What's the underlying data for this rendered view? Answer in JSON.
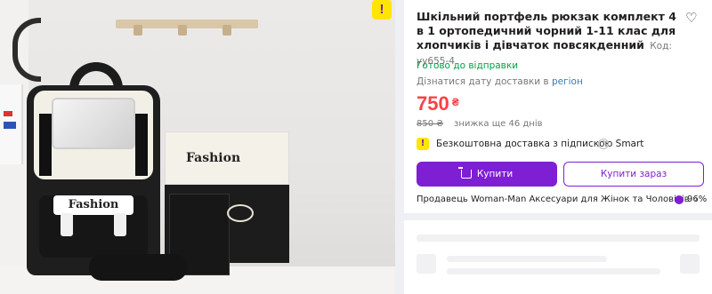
{
  "product": {
    "title": "Шкільний портфель рюкзак комплект 4 в 1 ор­топедичний чорний 1-11 клас для хлопчиків і дівчаток повсякденний",
    "code": "Код: уу655-4",
    "stock_status": "Готово до відправки",
    "delivery_prefix": "Дізнатися дату доставки в",
    "delivery_region": "регіон",
    "price": "750",
    "currency": "₴",
    "old_price": "850 ₴",
    "discount_note": "знижка ще 46 днів",
    "smart_text": "Безкоштовна доставка з підпискою Smart",
    "buy_label": "Купити",
    "buy_now_label": "Купити зараз",
    "seller_text": "Продавець Woman-Man Аксесуари для Жінок та Чоловіків",
    "seller_chevron": "›",
    "rating": "96%"
  },
  "image": {
    "bag_label_1": "Fashion",
    "bag_label_2": "Fashion"
  },
  "icons": {
    "brand": "!",
    "smart": "!",
    "heart": "♡",
    "info": "?"
  },
  "colors": {
    "accent": "#7e1fd4",
    "price": "#f84147",
    "in_stock": "#00a046",
    "link": "#3e77aa",
    "brand_yellow": "#ffe500"
  }
}
